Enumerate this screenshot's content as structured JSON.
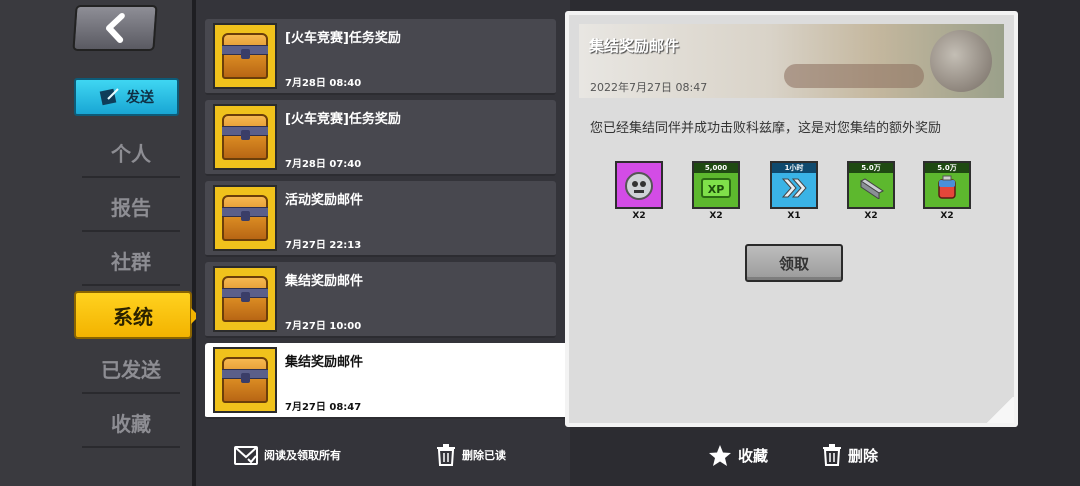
{
  "sidebar": {
    "send_label": "发送",
    "items": [
      {
        "label": "个人"
      },
      {
        "label": "报告"
      },
      {
        "label": "社群"
      },
      {
        "label": "系统"
      },
      {
        "label": "已发送"
      },
      {
        "label": "收藏"
      }
    ],
    "active_item": "系统"
  },
  "mail_list": {
    "items": [
      {
        "title": "[火车竞赛]任务奖励",
        "date": "7月28日 08:40"
      },
      {
        "title": "[火车竞赛]任务奖励",
        "date": "7月28日 07:40"
      },
      {
        "title": "活动奖励邮件",
        "date": "7月27日 22:13"
      },
      {
        "title": "集结奖励邮件",
        "date": "7月27日 10:00"
      },
      {
        "title": "集结奖励邮件",
        "date": "7月27日 08:47"
      }
    ],
    "selected_index": 4
  },
  "left_toolbar": {
    "read_all_label": "阅读及领取所有",
    "delete_read_label": "删除已读"
  },
  "detail": {
    "title": "集结奖励邮件",
    "date": "2022年7月27日 08:47",
    "body": "您已经集结同伴并成功击败科兹摩，这是对您集结的额外奖励",
    "rewards": [
      {
        "icon": "skull-medal-icon",
        "tag": "",
        "qty": "X2",
        "color": "#d34ce6"
      },
      {
        "icon": "xp-ticket-icon",
        "tag": "5,000",
        "qty": "X2",
        "color": "#5db82e"
      },
      {
        "icon": "speedup-arrows-icon",
        "tag": "1小时",
        "qty": "X1",
        "color": "#3ab3e6"
      },
      {
        "icon": "steel-beam-icon",
        "tag": "5.0万",
        "qty": "X2",
        "color": "#5db82e"
      },
      {
        "icon": "fuel-canister-icon",
        "tag": "5.0万",
        "qty": "X2",
        "color": "#5db82e"
      }
    ],
    "claim_label": "领取"
  },
  "right_toolbar": {
    "favorite_label": "收藏",
    "delete_label": "删除"
  }
}
